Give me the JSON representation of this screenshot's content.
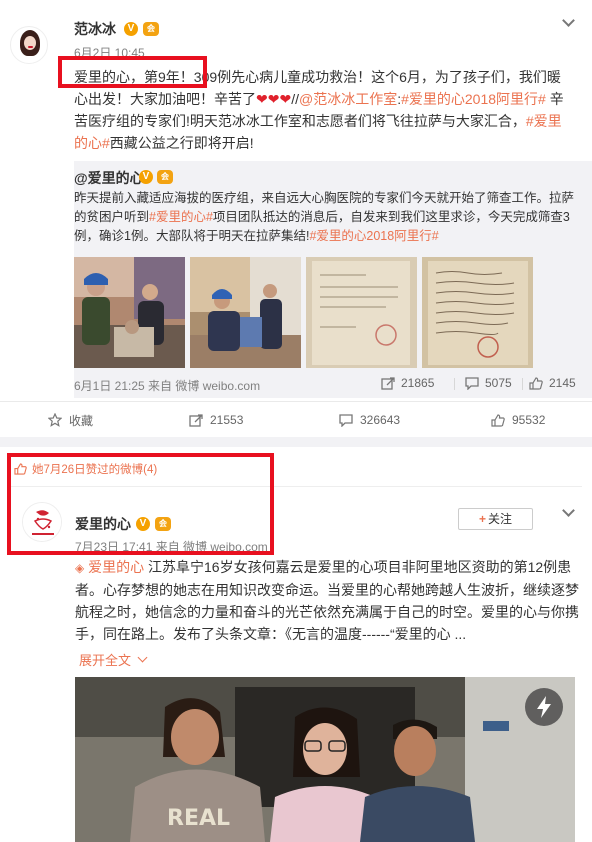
{
  "post1": {
    "author": "范冰冰",
    "verified_badge": "V",
    "vip_badge": "会",
    "time": "6月2日 10:45",
    "text_segments": [
      {
        "t": "爱里的心，第9年！309例先心病儿童成功救治！这个6月，为了孩子们，我们暖心出发！大家加油吧！辛苦了",
        "c": "normal"
      },
      {
        "t": "❤❤❤",
        "c": "heart"
      },
      {
        "t": "//",
        "c": "normal"
      },
      {
        "t": "@范冰冰工作室",
        "c": "hl"
      },
      {
        "t": ":",
        "c": "normal"
      },
      {
        "t": "#爱里的心2018阿里行#",
        "c": "hl"
      },
      {
        "t": " 辛苦医疗组的专家们!明天范冰冰工作室和志愿者们将飞往拉萨与大家汇合，",
        "c": "normal"
      },
      {
        "t": "#爱里的心#",
        "c": "hl"
      },
      {
        "t": "西藏公益之行即将开启!",
        "c": "normal"
      }
    ],
    "repost": {
      "author": "@爱里的心",
      "verified_badge": "V",
      "vip_badge": "会",
      "text_segments": [
        {
          "t": "昨天提前入藏适应海拔的医疗组，来自远大心胸医院的专家们今天就开始了筛查工作。拉萨的贫困户听到",
          "c": "normal"
        },
        {
          "t": "#爱里的心#",
          "c": "hl"
        },
        {
          "t": "项目团队抵达的消息后，自发来到我们这里求诊，今天完成筛查3例，确诊1例。大部队将于明天在拉萨集结!",
          "c": "normal"
        },
        {
          "t": "#爱里的心2018阿里行#",
          "c": "hl"
        }
      ],
      "meta": "6月1日 21:25 来自 微博 weibo.com",
      "share_count": "21865",
      "comment_count": "5075",
      "like_count": "2145"
    },
    "actions": {
      "favorite_label": "收藏",
      "share_count": "21553",
      "comment_count": "326643",
      "like_count": "95532"
    }
  },
  "post2": {
    "liked_notice": "她7月26日赞过的微博(4)",
    "author": "爱里的心",
    "verified_badge": "V",
    "vip_badge": "会",
    "follow_label": "关注",
    "time": "7月23日 17:41 来自 微博 weibo.com",
    "text_segments": [
      {
        "t": "爱里的心",
        "c": "hl"
      },
      {
        "t": " 江苏阜宁16岁女孩何嘉云是爱里的心项目非阿里地区资助的第12例患者。心存梦想的她志在用知识改变命运。当爱里的心帮她跨越人生波折，继续逐梦航程之时，她信念的力量和奋斗的光芒依然充满属于自己的时空。爱里的心与你携手，同在路上。发布了头条文章：《无言的温度------“爱里的心 ...",
        "c": "normal"
      }
    ],
    "expand_label": "展开全文",
    "photo_shirt_text": "REAL"
  },
  "colors": {
    "accent": "#eb7350",
    "highlight_box": "#e8101f",
    "muted": "#808080",
    "repost_bg": "#f2f2f5"
  }
}
